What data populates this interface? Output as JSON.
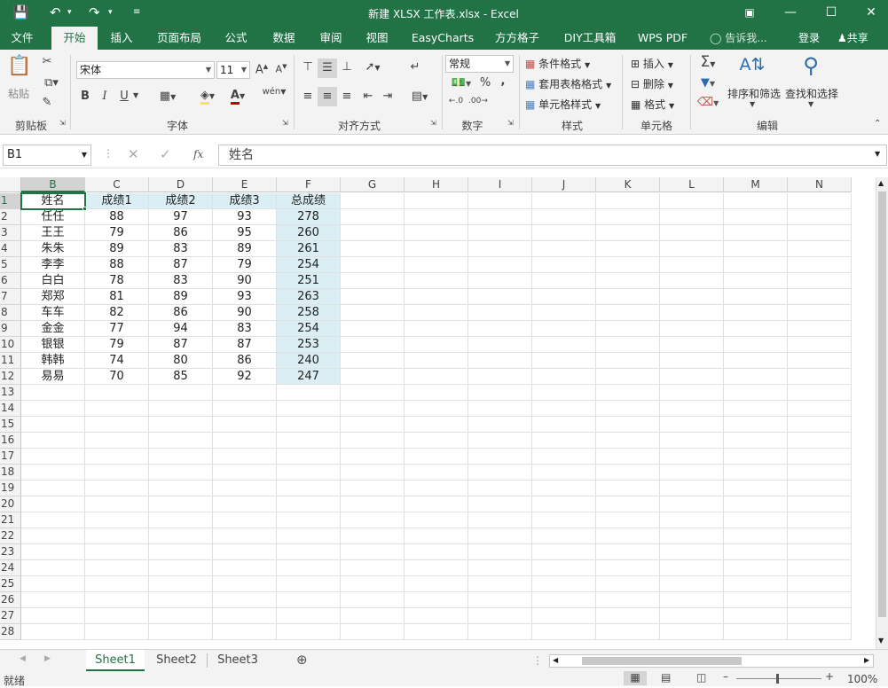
{
  "window": {
    "title": "新建 XLSX 工作表.xlsx - Excel"
  },
  "ribbon_tabs": [
    "文件",
    "开始",
    "插入",
    "页面布局",
    "公式",
    "数据",
    "审阅",
    "视图",
    "EasyCharts",
    "方方格子",
    "DIY工具箱",
    "WPS PDF"
  ],
  "tell_me": "告诉我...",
  "login": "登录",
  "share": "共享",
  "ribbon": {
    "clipboard": {
      "paste": "粘贴",
      "label": "剪贴板"
    },
    "font": {
      "name": "宋体",
      "size": "11",
      "label": "字体",
      "bold": "B",
      "italic": "I",
      "underline": "U",
      "pinyin": "wén"
    },
    "alignment": {
      "label": "对齐方式"
    },
    "number": {
      "format": "常规",
      "percent": "%",
      "comma": ",",
      "label": "数字"
    },
    "styles": {
      "conditional": "条件格式",
      "table": "套用表格格式",
      "cell": "单元格样式",
      "label": "样式"
    },
    "cells": {
      "insert": "插入",
      "delete": "删除",
      "format": "格式",
      "label": "单元格"
    },
    "editing": {
      "sort": "排序和筛选",
      "find": "查找和选择",
      "label": "编辑"
    }
  },
  "formula_bar": {
    "name_box": "B1",
    "fx": "fx",
    "content": "姓名"
  },
  "columns": [
    "B",
    "C",
    "D",
    "E",
    "F",
    "G",
    "H",
    "I",
    "J",
    "K",
    "L",
    "M",
    "N"
  ],
  "rows": [
    "1",
    "2",
    "3",
    "4",
    "5",
    "6",
    "7",
    "8",
    "9",
    "10",
    "11",
    "12",
    "13",
    "14",
    "15",
    "16",
    "17",
    "18",
    "19",
    "20",
    "21",
    "22",
    "23",
    "24",
    "25",
    "26",
    "27",
    "28"
  ],
  "table": {
    "headers": [
      "姓名",
      "成绩1",
      "成绩2",
      "成绩3",
      "总成绩"
    ],
    "data": [
      [
        "任任",
        "88",
        "97",
        "93",
        "278"
      ],
      [
        "王王",
        "79",
        "86",
        "95",
        "260"
      ],
      [
        "朱朱",
        "89",
        "83",
        "89",
        "261"
      ],
      [
        "李李",
        "88",
        "87",
        "79",
        "254"
      ],
      [
        "白白",
        "78",
        "83",
        "90",
        "251"
      ],
      [
        "郑郑",
        "81",
        "89",
        "93",
        "263"
      ],
      [
        "车车",
        "82",
        "86",
        "90",
        "258"
      ],
      [
        "金金",
        "77",
        "94",
        "83",
        "254"
      ],
      [
        "银银",
        "79",
        "87",
        "87",
        "253"
      ],
      [
        "韩韩",
        "74",
        "80",
        "86",
        "240"
      ],
      [
        "易易",
        "70",
        "85",
        "92",
        "247"
      ]
    ]
  },
  "sheets": [
    "Sheet1",
    "Sheet2",
    "Sheet3"
  ],
  "status": {
    "ready": "就绪",
    "zoom": "100%"
  },
  "colors": {
    "brand": "#217346",
    "highlight": "#daeef3"
  }
}
